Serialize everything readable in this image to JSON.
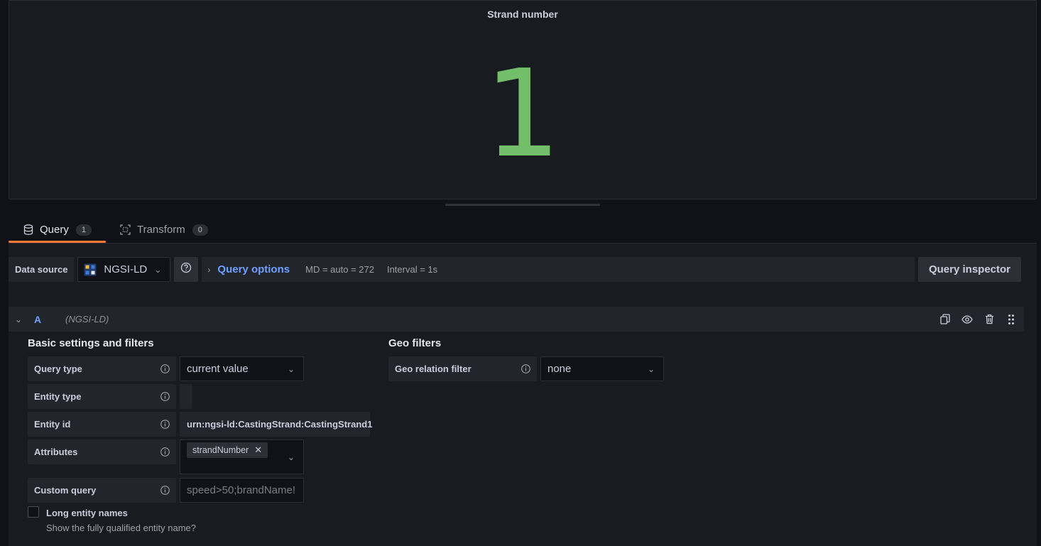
{
  "panel": {
    "title": "Strand number",
    "value": "1",
    "value_color": "#73bf69"
  },
  "tabs": [
    {
      "label": "Query",
      "count": "1",
      "icon": "database-icon",
      "active": true
    },
    {
      "label": "Transform",
      "count": "0",
      "icon": "transform-icon",
      "active": false
    }
  ],
  "toolbar": {
    "ds_label": "Data source",
    "ds_value": "NGSI-LD",
    "query_options": "Query options",
    "md": "MD = auto = 272",
    "interval": "Interval = 1s",
    "query_inspector": "Query inspector"
  },
  "query": {
    "letter": "A",
    "datasource": "(NGSI-LD)"
  },
  "basic": {
    "title": "Basic settings and filters",
    "query_type_label": "Query type",
    "query_type_value": "current value",
    "entity_type_label": "Entity type",
    "entity_type_value": "",
    "entity_id_label": "Entity id",
    "entity_id_value": "urn:ngsi-ld:CastingStrand:CastingStrand1",
    "attributes_label": "Attributes",
    "attribute_tag": "strandNumber",
    "custom_query_label": "Custom query",
    "custom_query_placeholder": "speed>50;brandName!",
    "long_names_label": "Long entity names",
    "long_names_desc": "Show the fully qualified entity name?"
  },
  "geo": {
    "title": "Geo filters",
    "relation_label": "Geo relation filter",
    "relation_value": "none"
  },
  "colors": {
    "accent": "#ff7830",
    "link": "#6e9fff"
  }
}
